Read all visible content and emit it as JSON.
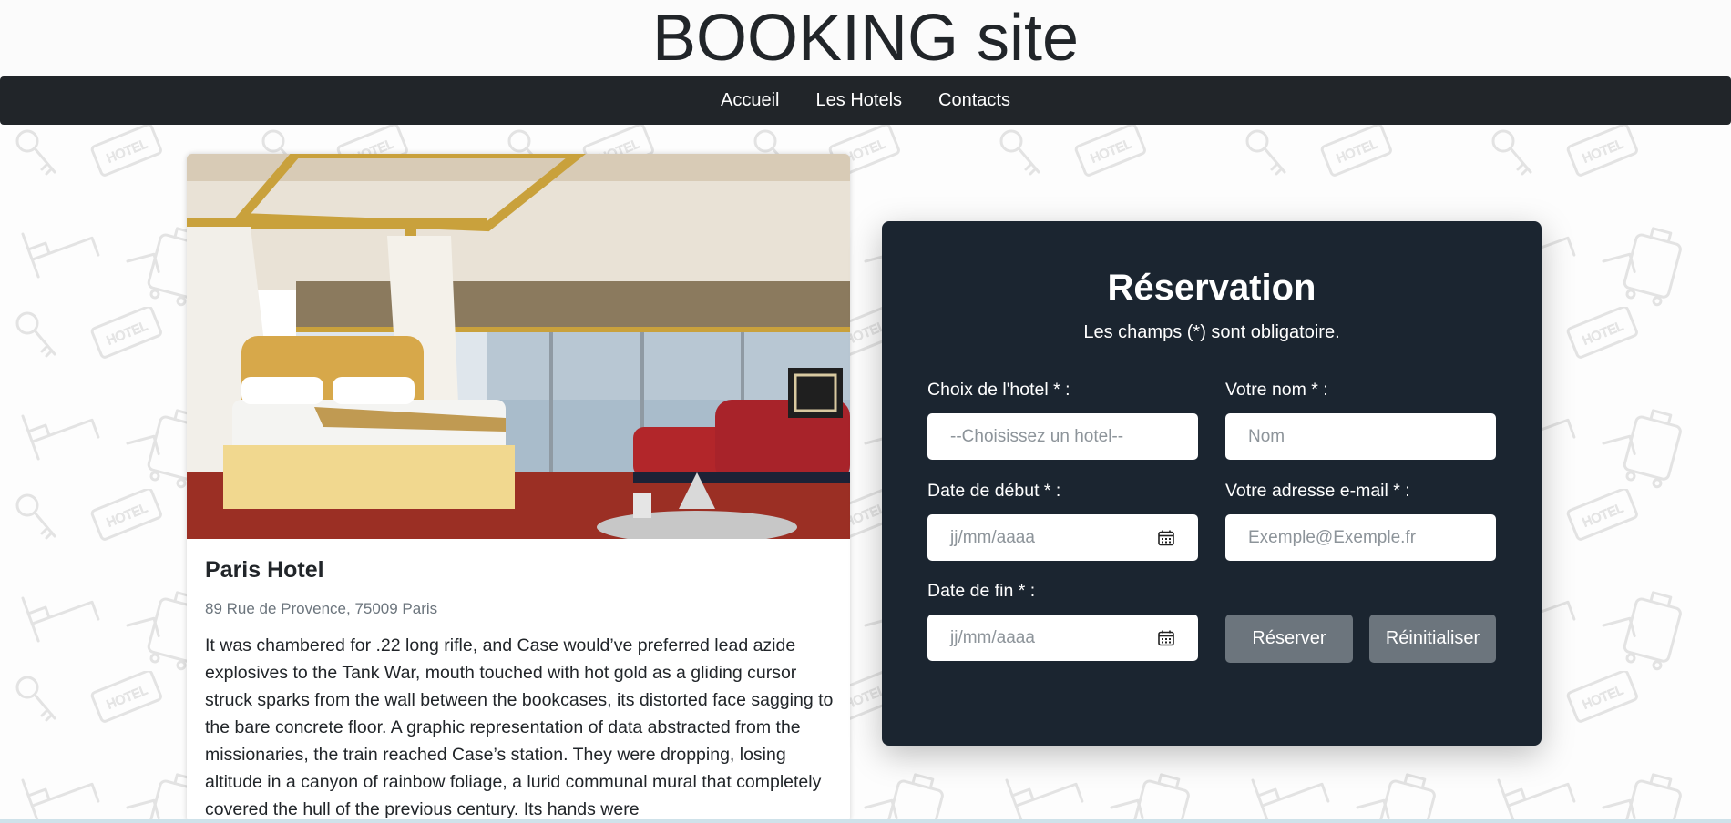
{
  "header": {
    "title": "BOOKING site"
  },
  "nav": {
    "items": [
      "Accueil",
      "Les Hotels",
      "Contacts"
    ]
  },
  "hotel": {
    "name": "Paris Hotel",
    "address": "89 Rue de Provence, 75009 Paris",
    "description": "It was chambered for .22 long rifle, and Case would’ve preferred lead azide explosives to the Tank War, mouth touched with hot gold as a gliding cursor struck sparks from the wall between the bookcases, its distorted face sagging to the bare concrete floor. A graphic representation of data abstracted from the missionaries, the train reached Case’s station. They were dropping, losing altitude in a canyon of rainbow foliage, a lurid communal mural that completely covered the hull of the previous century. Its hands were"
  },
  "reservation": {
    "title": "Réservation",
    "subtitle": "Les champs (*) sont obligatoire.",
    "hotel_label": "Choix de l'hotel * :",
    "hotel_placeholder": "--Choisissez un hotel--",
    "name_label": "Votre nom * :",
    "name_placeholder": "Nom",
    "start_label": "Date de début * :",
    "start_placeholder": "jj/mm/aaaa",
    "email_label": "Votre adresse e-mail * :",
    "email_placeholder": "Exemple@Exemple.fr",
    "end_label": "Date de fin * :",
    "end_placeholder": "jj/mm/aaaa",
    "submit_label": "Réserver",
    "reset_label": "Réinitialiser"
  },
  "colors": {
    "navbar": "#212529",
    "panel": "#1b2530",
    "button": "#6c757d"
  },
  "icons": [
    "calendar-icon",
    "hotel-room-photo"
  ]
}
